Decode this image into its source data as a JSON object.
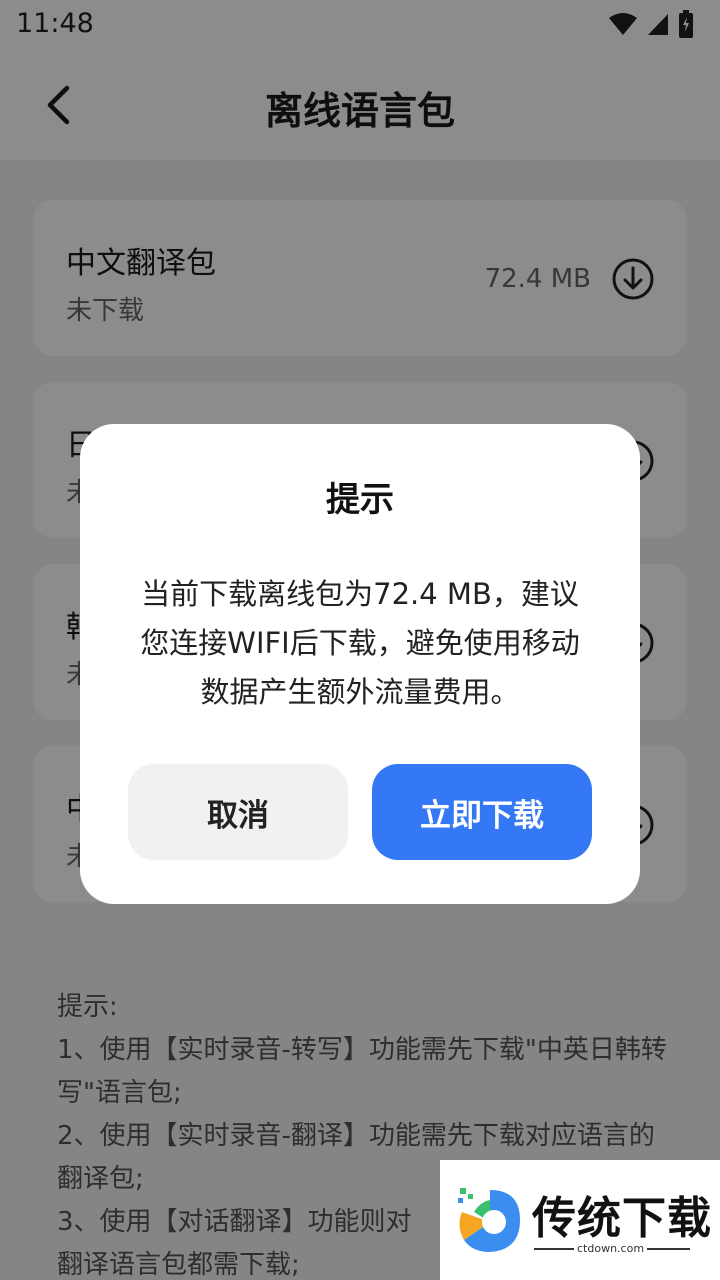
{
  "status_bar": {
    "time": "11:48"
  },
  "header": {
    "title": "离线语言包"
  },
  "packages": [
    {
      "name": "中文翻译包",
      "status": "未下载",
      "size": "72.4 MB"
    },
    {
      "name": "日",
      "status": "未",
      "size": ""
    },
    {
      "name": "韩",
      "status": "未",
      "size": ""
    },
    {
      "name": "中",
      "status": "未",
      "size": ""
    }
  ],
  "tips": {
    "heading": "提示:",
    "line1": "1、使用【实时录音-转写】功能需先下载\"中英日韩转写\"语言包;",
    "line2": "2、使用【实时录音-翻译】功能需先下载对应语言的翻译包;",
    "line3": "3、使用【对话翻译】功能则对",
    "line4": "翻译语言包都需下载;"
  },
  "dialog": {
    "title": "提示",
    "message": "当前下载离线包为72.4 MB，建议您连接WIFI后下载，避免使用移动数据产生额外流量费用。",
    "cancel_label": "取消",
    "confirm_label": "立即下载"
  },
  "watermark": {
    "brand": "传统下载",
    "url": "ctdown.com"
  },
  "colors": {
    "accent": "#3478f6",
    "overlay": "rgba(0,0,0,0.45)"
  }
}
